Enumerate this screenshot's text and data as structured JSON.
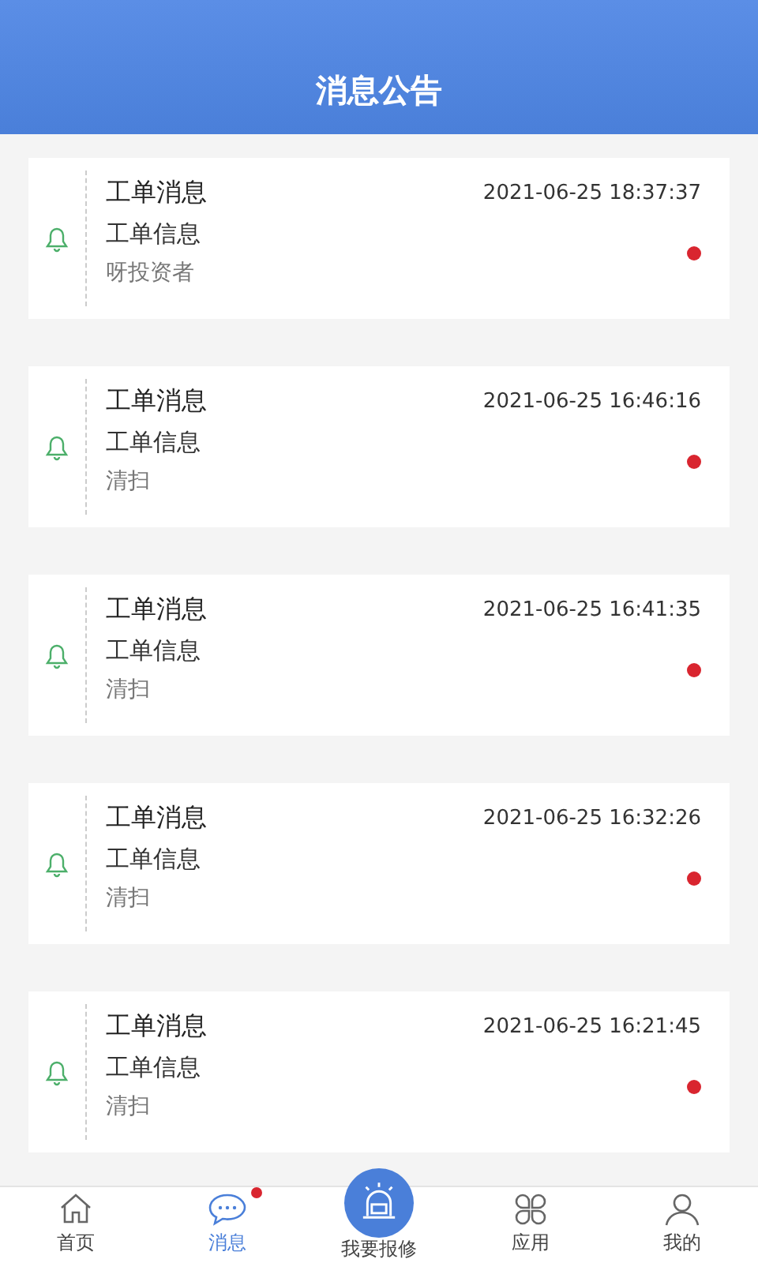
{
  "header": {
    "title": "消息公告"
  },
  "messages": [
    {
      "title": "工单消息",
      "time": "2021-06-25 18:37:37",
      "subtitle": "工单信息",
      "body": "呀投资者",
      "unread": true
    },
    {
      "title": "工单消息",
      "time": "2021-06-25 16:46:16",
      "subtitle": "工单信息",
      "body": "清扫",
      "unread": true
    },
    {
      "title": "工单消息",
      "time": "2021-06-25 16:41:35",
      "subtitle": "工单信息",
      "body": "清扫",
      "unread": true
    },
    {
      "title": "工单消息",
      "time": "2021-06-25 16:32:26",
      "subtitle": "工单信息",
      "body": "清扫",
      "unread": true
    },
    {
      "title": "工单消息",
      "time": "2021-06-25 16:21:45",
      "subtitle": "工单信息",
      "body": "清扫",
      "unread": true
    }
  ],
  "tab_bar": [
    {
      "kind": "home",
      "label": "首页",
      "selected": false,
      "badge": false
    },
    {
      "kind": "chat",
      "label": "消息",
      "selected": true,
      "badge": true
    },
    {
      "kind": "alarm",
      "label": "我要报修",
      "selected": false,
      "badge": false
    },
    {
      "kind": "apps",
      "label": "应用",
      "selected": false,
      "badge": false
    },
    {
      "kind": "user",
      "label": "我的",
      "selected": false,
      "badge": false
    }
  ]
}
